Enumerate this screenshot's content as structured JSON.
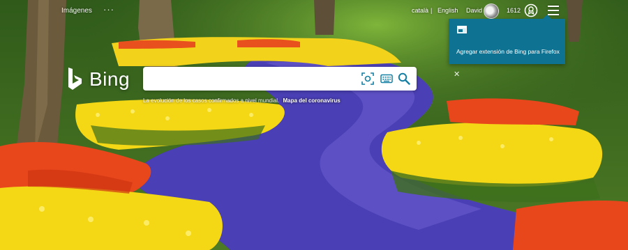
{
  "nav": {
    "images_label": "Imágenes",
    "more_label": "···"
  },
  "header": {
    "lang_catalan": "català",
    "separator": "|",
    "lang_english": "English",
    "user_name": "David",
    "reward_points": "1612",
    "rewards_icon": "rewards-medal-icon",
    "menu_icon": "hamburger-menu-icon"
  },
  "popup": {
    "text": "Agregar extensión de Bing para Firefox",
    "close_label": "✕"
  },
  "brand": {
    "name": "Bing",
    "logo_color": "#ffffff"
  },
  "search": {
    "value": "",
    "placeholder": "",
    "accent_color": "#0e7393"
  },
  "news": {
    "text": "La evolución de los casos confirmados a nivel mundial.",
    "link_label": "Mapa del coronavirus"
  },
  "colors": {
    "popup_bg": "#0e7393",
    "search_icon": "#137fa3"
  }
}
